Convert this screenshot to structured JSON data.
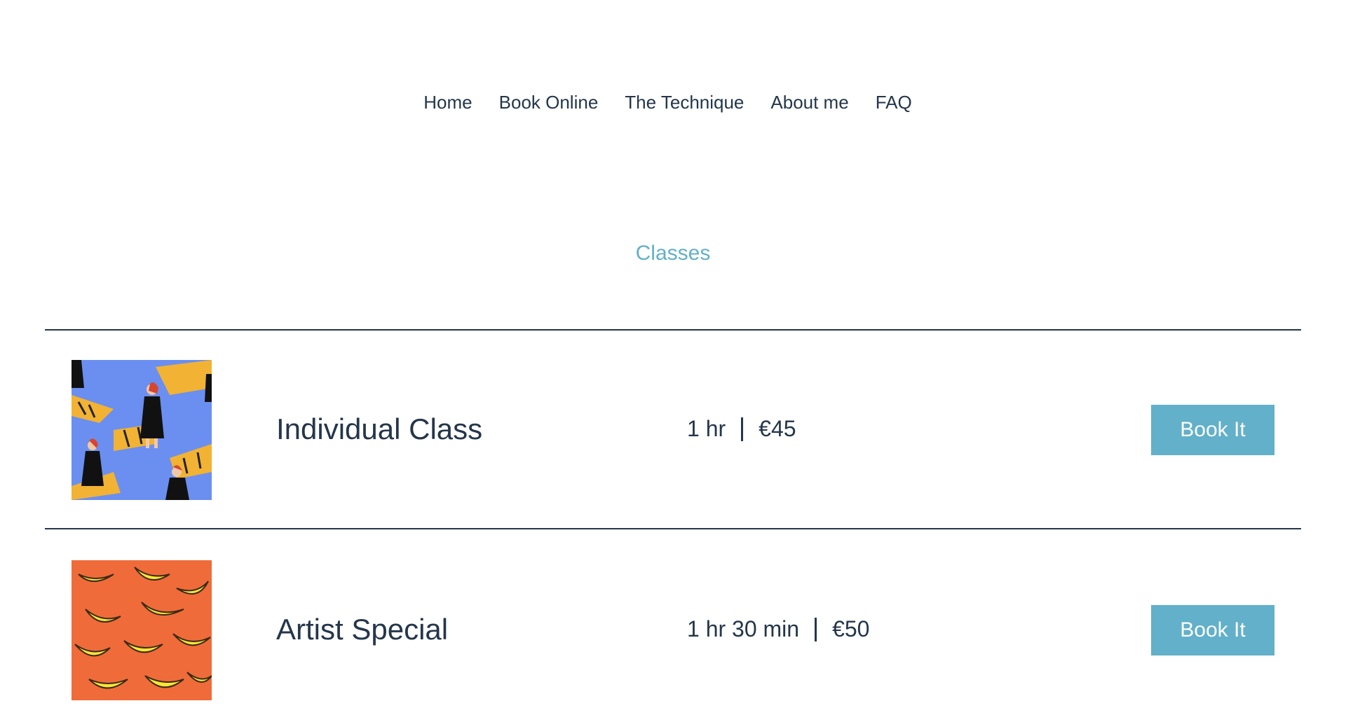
{
  "nav": {
    "items": [
      {
        "label": "Home"
      },
      {
        "label": "Book Online"
      },
      {
        "label": "The Technique"
      },
      {
        "label": "About me"
      },
      {
        "label": "FAQ"
      }
    ]
  },
  "main": {
    "title": "Classes",
    "accent_color": "#62b0c9",
    "text_color": "#24364b",
    "services": [
      {
        "name": "Individual Class",
        "duration": "1 hr",
        "price": "€45",
        "button_label": "Book It",
        "image_icon": "woman-tiger-pattern-image"
      },
      {
        "name": "Artist Special",
        "duration": "1 hr 30 min",
        "price": "€50",
        "button_label": "Book It",
        "image_icon": "banana-pattern-image"
      }
    ]
  }
}
